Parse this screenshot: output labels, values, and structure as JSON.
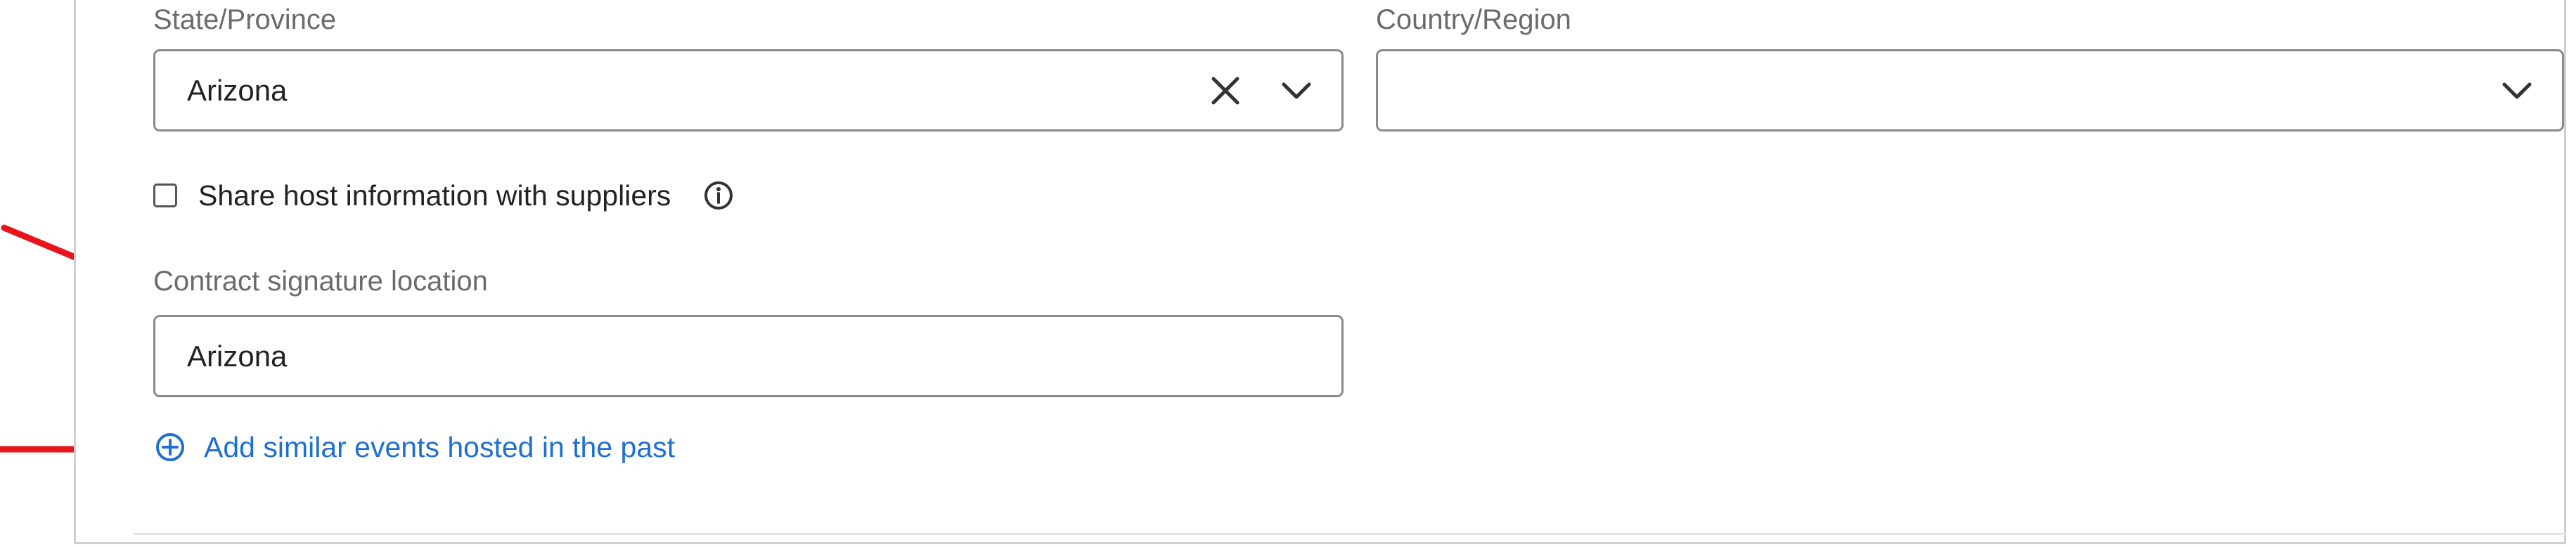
{
  "state_field": {
    "label": "State/Province",
    "value": "Arizona",
    "clear_icon": "close-icon",
    "dropdown_icon": "chevron-down-icon"
  },
  "country_field": {
    "label": "Country/Region",
    "value": "",
    "dropdown_icon": "chevron-down-icon"
  },
  "share_host": {
    "label": "Share host information with suppliers",
    "checked": false,
    "info_icon": "info-icon"
  },
  "contract_location": {
    "label": "Contract signature location",
    "value": "Arizona"
  },
  "add_similar_events": {
    "label": "Add similar events hosted in the past",
    "icon": "plus-circle-icon"
  },
  "colors": {
    "link": "#1f6fd1",
    "annotation_arrow": "#e8131b",
    "field_border": "#8a8a8a",
    "label_text": "#6b6b6b"
  }
}
